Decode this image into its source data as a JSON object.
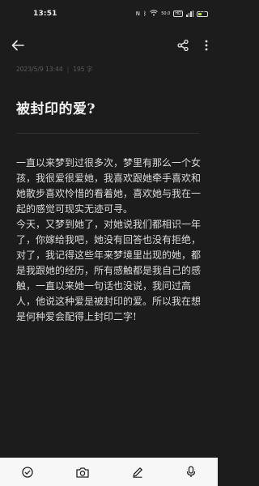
{
  "status_bar": {
    "time": "13:51",
    "icons": [
      "nfc-icon",
      "bluetooth-icon",
      "wifi-icon",
      "hd-icon",
      "signal-icon",
      "battery-icon"
    ],
    "wifi_speed": "50.0",
    "battery_level": "35"
  },
  "toolbar": {
    "back_icon": "arrow-left-icon",
    "share_icon": "share-icon",
    "more_icon": "more-vertical-icon"
  },
  "note": {
    "date": "2023/5/9 13:44",
    "word_count": "195 字",
    "title": "被封印的爱?",
    "paragraphs": [
      "一直以来梦到过很多次，梦里有那么一个女孩，我很爱很爱她，我喜欢跟她牵手喜欢和她散步喜欢怜惜的看着她，喜欢她与我在一起的感觉可现实无迹可寻。",
      "今天，又梦到她了，对她说我们都相识一年了，你嫁给我吧，她没有回答也没有拒绝，对了，我记得这些年来梦境里出现的她，都是我跟她的经历，所有感触都是我自己的感触，一直以来她一句话也没说，我问过高人，他说这种爱是被封印的爱。所以我在想是何种爱会配得上封印二字!"
    ]
  },
  "bottom_bar": {
    "icons": [
      "check-circle-icon",
      "camera-icon",
      "pen-icon",
      "microphone-icon"
    ]
  },
  "colors": {
    "background": "#1c1c1c",
    "bottom_bar": "#f7f7f7",
    "text": "#dcdcdc",
    "meta": "#5d5d5d"
  }
}
